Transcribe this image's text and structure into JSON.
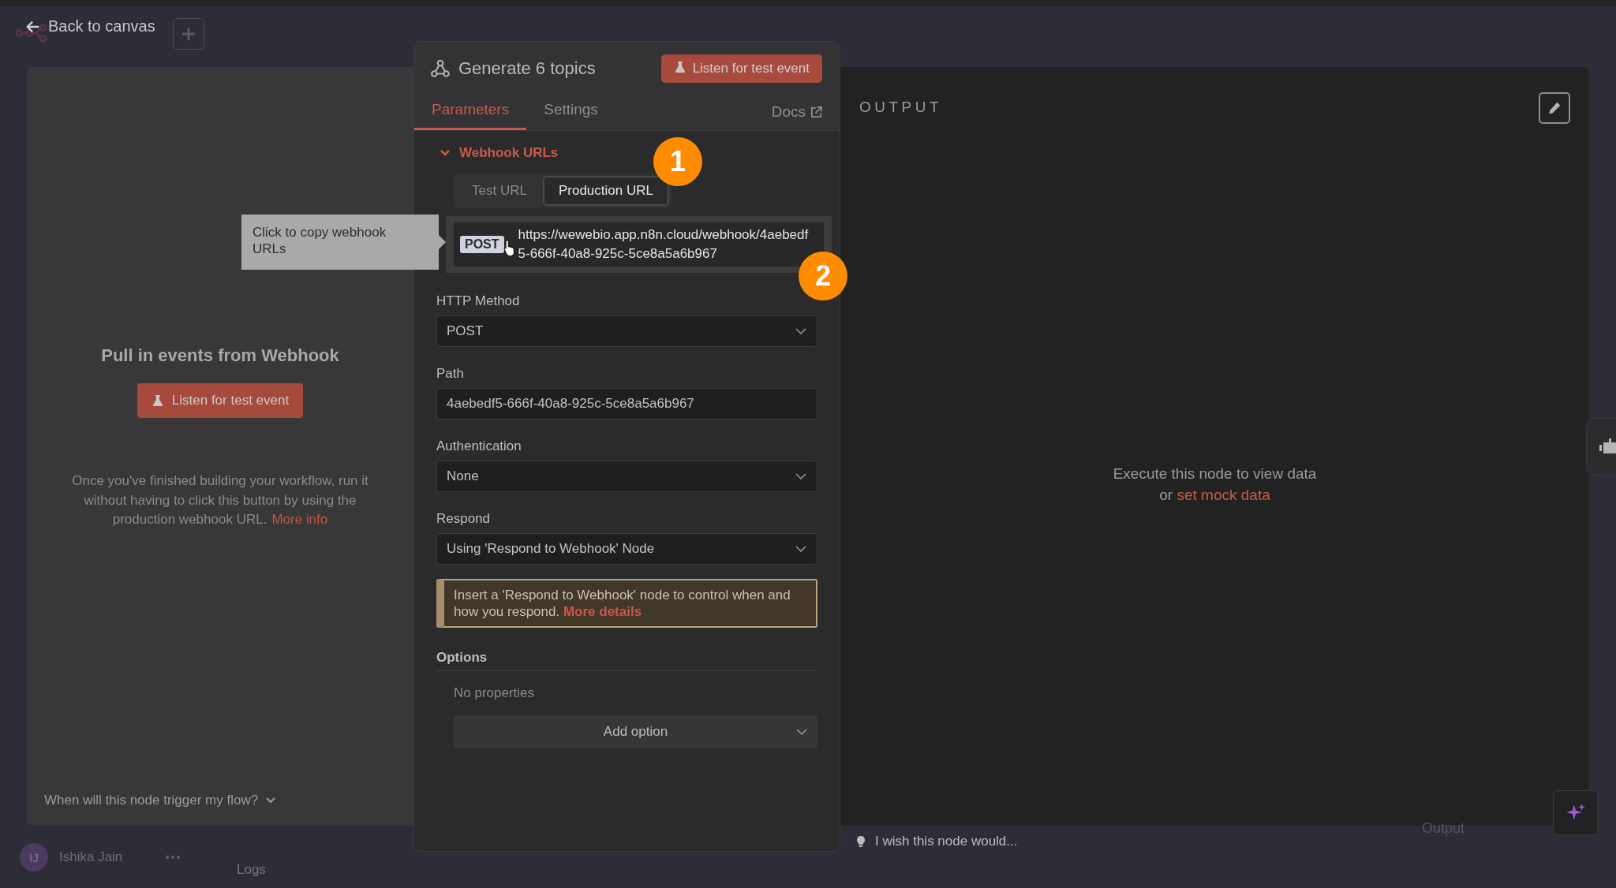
{
  "header": {
    "back_label": "Back to canvas"
  },
  "trigger_panel": {
    "title": "Pull in events from Webhook",
    "button": "Listen for test event",
    "description": "Once you've finished building your workflow, run it without having to click this button by using the production webhook URL.",
    "link": "More info",
    "footer": "When will this node trigger my flow?"
  },
  "node_panel": {
    "title": "Generate 6 topics",
    "button": "Listen for test event",
    "tabs": [
      {
        "label": "Parameters",
        "selected": true
      },
      {
        "label": "Settings",
        "selected": false
      }
    ],
    "docs": "Docs",
    "section": {
      "label": "Webhook URLs",
      "expanded": true
    },
    "url_tabs": [
      {
        "label": "Test URL",
        "selected": false
      },
      {
        "label": "Production URL",
        "selected": true
      }
    ],
    "method_badge": "POST",
    "url": "https://wewebio.app.n8n.cloud/webhook/4aebedf5-666f-40a8-925c-5ce8a5a6b967",
    "fields": [
      {
        "label": "HTTP Method",
        "kind": "select",
        "value": "POST"
      },
      {
        "label": "Path",
        "kind": "text",
        "value": "4aebedf5-666f-40a8-925c-5ce8a5a6b967"
      },
      {
        "label": "Authentication",
        "kind": "select",
        "value": "None"
      },
      {
        "label": "Respond",
        "kind": "select",
        "value": "Using 'Respond to Webhook' Node"
      }
    ],
    "notice": {
      "text": "Insert a 'Respond to Webhook' node to control when and how you respond.",
      "link": "More details"
    },
    "options": {
      "label": "Options",
      "empty": "No properties",
      "add": "Add option"
    }
  },
  "tooltip": "Click to copy webhook URLs",
  "callouts": [
    "1",
    "2"
  ],
  "output_panel": {
    "title": "OUTPUT",
    "message": "Execute this node to view data",
    "or": "or",
    "link": "set mock data"
  },
  "background": {
    "user_initials": "IJ",
    "user_name": "Ishika Jain",
    "logs": "Logs",
    "feedback": "I wish this node would...",
    "output_label": "Output"
  }
}
